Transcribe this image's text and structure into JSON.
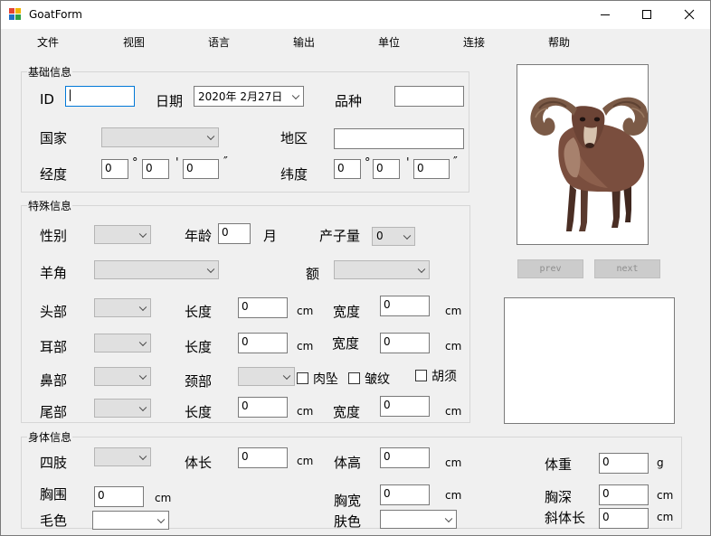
{
  "window": {
    "title": "GoatForm"
  },
  "menu": [
    "文件",
    "视图",
    "语言",
    "输出",
    "单位",
    "连接",
    "帮助"
  ],
  "basic": {
    "group_label": "基础信息",
    "id_label": "ID",
    "id_value": "",
    "date_label": "日期",
    "date_value": "2020年  2月27日",
    "breed_label": "品种",
    "breed_value": "",
    "country_label": "国家",
    "country_value": "",
    "region_label": "地区",
    "region_value": "",
    "longitude_label": "经度",
    "latitude_label": "纬度",
    "lon_deg": "0",
    "lon_min": "0",
    "lon_sec": "0",
    "lat_deg": "0",
    "lat_min": "0",
    "lat_sec": "0",
    "deg_sym": "°",
    "min_sym": "'",
    "sec_sym": "″"
  },
  "special": {
    "group_label": "特殊信息",
    "sex_label": "性别",
    "sex_value": "",
    "age_label": "年龄",
    "age_value": "0",
    "age_unit": "月",
    "litter_label": "产子量",
    "litter_value": "0",
    "horn_label": "羊角",
    "horn_value": "",
    "forehead_label": "额",
    "forehead_value": "",
    "head_label": "头部",
    "head_value": "",
    "ear_label": "耳部",
    "ear_value": "",
    "nose_label": "鼻部",
    "nose_value": "",
    "tail_label": "尾部",
    "tail_value": "",
    "length_label": "长度",
    "width_label": "宽度",
    "head_length": "0",
    "head_width": "0",
    "ear_length": "0",
    "ear_width": "0",
    "tail_length": "0",
    "tail_width": "0",
    "neck_label": "颈部",
    "neck_value": "",
    "wattle_label": "肉坠",
    "wrinkle_label": "皱纹",
    "beard_label": "胡须",
    "unit_cm": "cm"
  },
  "body": {
    "group_label": "身体信息",
    "limbs_label": "四肢",
    "limbs_value": "",
    "body_length_label": "体长",
    "body_length": "0",
    "body_height_label": "体高",
    "body_height": "0",
    "weight_label": "体重",
    "weight": "0",
    "weight_unit": "g",
    "chest_girth_label": "胸围",
    "chest_girth": "0",
    "chest_width_label": "胸宽",
    "chest_width": "0",
    "chest_depth_label": "胸深",
    "chest_depth": "0",
    "coat_color_label": "毛色",
    "coat_color": "",
    "skin_color_label": "肤色",
    "skin_color": "",
    "oblique_length_label": "斜体长",
    "oblique_length": "0",
    "unit_cm": "cm"
  },
  "side": {
    "prev_label": "prev",
    "next_label": "next",
    "notes_value": ""
  }
}
